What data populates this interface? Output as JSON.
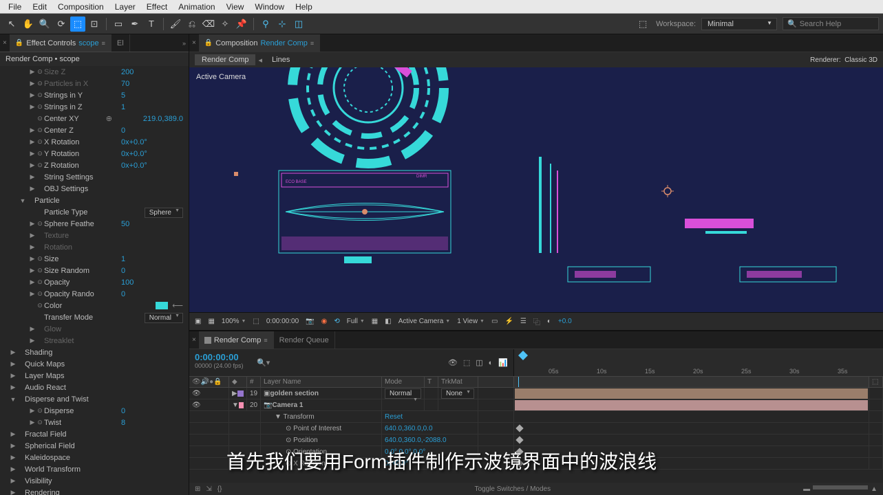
{
  "menu": {
    "items": [
      "File",
      "Edit",
      "Composition",
      "Layer",
      "Effect",
      "Animation",
      "View",
      "Window",
      "Help"
    ]
  },
  "workspace": {
    "label": "Workspace:",
    "value": "Minimal",
    "search": "Search Help"
  },
  "effectsPanel": {
    "tabTitle": "Effect Controls",
    "tabSubject": "scope",
    "crumb": "Render Comp • scope",
    "props": [
      {
        "d": 3,
        "tw": "▶",
        "sw": "⊙",
        "label": "Size Z",
        "val": "200",
        "dim": true
      },
      {
        "d": 3,
        "tw": "▶",
        "sw": "⊙",
        "label": "Particles in X",
        "val": "70",
        "dim": true
      },
      {
        "d": 3,
        "tw": "▶",
        "sw": "⊙",
        "label": "Strings in Y",
        "val": "5"
      },
      {
        "d": 3,
        "tw": "▶",
        "sw": "⊙",
        "label": "Strings in Z",
        "val": "1"
      },
      {
        "d": 3,
        "tw": "",
        "sw": "⊙",
        "label": "Center XY",
        "val": "219.0,389.0",
        "target": true
      },
      {
        "d": 3,
        "tw": "▶",
        "sw": "⊙",
        "label": "Center Z",
        "val": "0"
      },
      {
        "d": 3,
        "tw": "▶",
        "sw": "⊙",
        "label": "X Rotation",
        "val": "0x+0.0°"
      },
      {
        "d": 3,
        "tw": "▶",
        "sw": "⊙",
        "label": "Y Rotation",
        "val": "0x+0.0°"
      },
      {
        "d": 3,
        "tw": "▶",
        "sw": "⊙",
        "label": "Z Rotation",
        "val": "0x+0.0°"
      },
      {
        "d": 3,
        "tw": "▶",
        "sw": "",
        "label": "String Settings",
        "val": ""
      },
      {
        "d": 3,
        "tw": "▶",
        "sw": "",
        "label": "OBJ Settings",
        "val": ""
      },
      {
        "d": 2,
        "tw": "▼",
        "sw": "",
        "label": "Particle",
        "val": "",
        "group": true
      },
      {
        "d": 3,
        "tw": "",
        "sw": "",
        "label": "Particle Type",
        "val": "",
        "dd": "Sphere"
      },
      {
        "d": 3,
        "tw": "▶",
        "sw": "⊙",
        "label": "Sphere Feathe",
        "val": "50"
      },
      {
        "d": 3,
        "tw": "▶",
        "sw": "",
        "label": "Texture",
        "val": "",
        "dim": true
      },
      {
        "d": 3,
        "tw": "▶",
        "sw": "",
        "label": "Rotation",
        "val": "",
        "dim": true
      },
      {
        "d": 3,
        "tw": "▶",
        "sw": "⊙",
        "label": "Size",
        "val": "1"
      },
      {
        "d": 3,
        "tw": "▶",
        "sw": "⊙",
        "label": "Size Random",
        "val": "0"
      },
      {
        "d": 3,
        "tw": "▶",
        "sw": "⊙",
        "label": "Opacity",
        "val": "100"
      },
      {
        "d": 3,
        "tw": "▶",
        "sw": "⊙",
        "label": "Opacity Rando",
        "val": "0"
      },
      {
        "d": 3,
        "tw": "",
        "sw": "⊙",
        "label": "Color",
        "val": "",
        "swatch": true
      },
      {
        "d": 3,
        "tw": "",
        "sw": "",
        "label": "Transfer Mode",
        "val": "",
        "dd": "Normal"
      },
      {
        "d": 3,
        "tw": "▶",
        "sw": "",
        "label": "Glow",
        "val": "",
        "dim": true
      },
      {
        "d": 3,
        "tw": "▶",
        "sw": "",
        "label": "Streaklet",
        "val": "",
        "dim": true
      },
      {
        "d": 1,
        "tw": "▶",
        "sw": "",
        "label": "Shading",
        "val": ""
      },
      {
        "d": 1,
        "tw": "▶",
        "sw": "",
        "label": "Quick Maps",
        "val": ""
      },
      {
        "d": 1,
        "tw": "▶",
        "sw": "",
        "label": "Layer Maps",
        "val": ""
      },
      {
        "d": 1,
        "tw": "▶",
        "sw": "",
        "label": "Audio React",
        "val": ""
      },
      {
        "d": 1,
        "tw": "▼",
        "sw": "",
        "label": "Disperse and Twist",
        "val": "",
        "group": true
      },
      {
        "d": 3,
        "tw": "▶",
        "sw": "⊙",
        "label": "Disperse",
        "val": "0"
      },
      {
        "d": 3,
        "tw": "▶",
        "sw": "⊙",
        "label": "Twist",
        "val": "8"
      },
      {
        "d": 1,
        "tw": "▶",
        "sw": "",
        "label": "Fractal Field",
        "val": ""
      },
      {
        "d": 1,
        "tw": "▶",
        "sw": "",
        "label": "Spherical Field",
        "val": ""
      },
      {
        "d": 1,
        "tw": "▶",
        "sw": "",
        "label": "Kaleidospace",
        "val": ""
      },
      {
        "d": 1,
        "tw": "▶",
        "sw": "",
        "label": "World Transform",
        "val": ""
      },
      {
        "d": 1,
        "tw": "▶",
        "sw": "",
        "label": "Visibility",
        "val": ""
      },
      {
        "d": 1,
        "tw": "▶",
        "sw": "",
        "label": "Rendering",
        "val": ""
      }
    ]
  },
  "compPanel": {
    "tabTitle": "Composition",
    "tabSubject": "Render Comp",
    "navActive": "Render Comp",
    "navSub": "Lines",
    "rendererLabel": "Renderer:",
    "rendererVal": "Classic 3D",
    "activeCamera": "Active Camera"
  },
  "viewerControls": {
    "zoom": "100%",
    "time": "0:00:00:00",
    "res": "Full",
    "camera": "Active Camera",
    "view": "1 View",
    "exposure": "+0.0"
  },
  "timeline": {
    "tabActive": "Render Comp",
    "tabOther": "Render Queue",
    "timecode": "0:00:00:00",
    "fps": "00000 (24.00 fps)",
    "cols": {
      "num": "#",
      "layerName": "Layer Name",
      "mode": "Mode",
      "t": "T",
      "trkMat": "TrkMat"
    },
    "ticks": [
      "05s",
      "10s",
      "15s",
      "20s",
      "25s",
      "30s",
      "35s"
    ],
    "rows": [
      {
        "idx": "19",
        "name": "golden section",
        "mode": "Normal",
        "trk": "None",
        "color": "#9575cd"
      },
      {
        "idx": "20",
        "name": "Camera 1",
        "mode": "",
        "trk": "",
        "color": "#f48fb1"
      }
    ],
    "transform": {
      "label": "Transform",
      "reset": "Reset",
      "props": [
        {
          "label": "Point of Interest",
          "val": "640.0,360.0,0.0"
        },
        {
          "label": "Position",
          "val": "640.0,360.0,-2088.0"
        },
        {
          "label": "Orientation",
          "val": "0.0°,0.0°,0.0°"
        },
        {
          "label": "X Rotation",
          "val": "0x+0.0°"
        }
      ]
    },
    "footer": "Toggle Switches / Modes"
  },
  "subtitle": "首先我们要用Form插件制作示波镜界面中的波浪线"
}
